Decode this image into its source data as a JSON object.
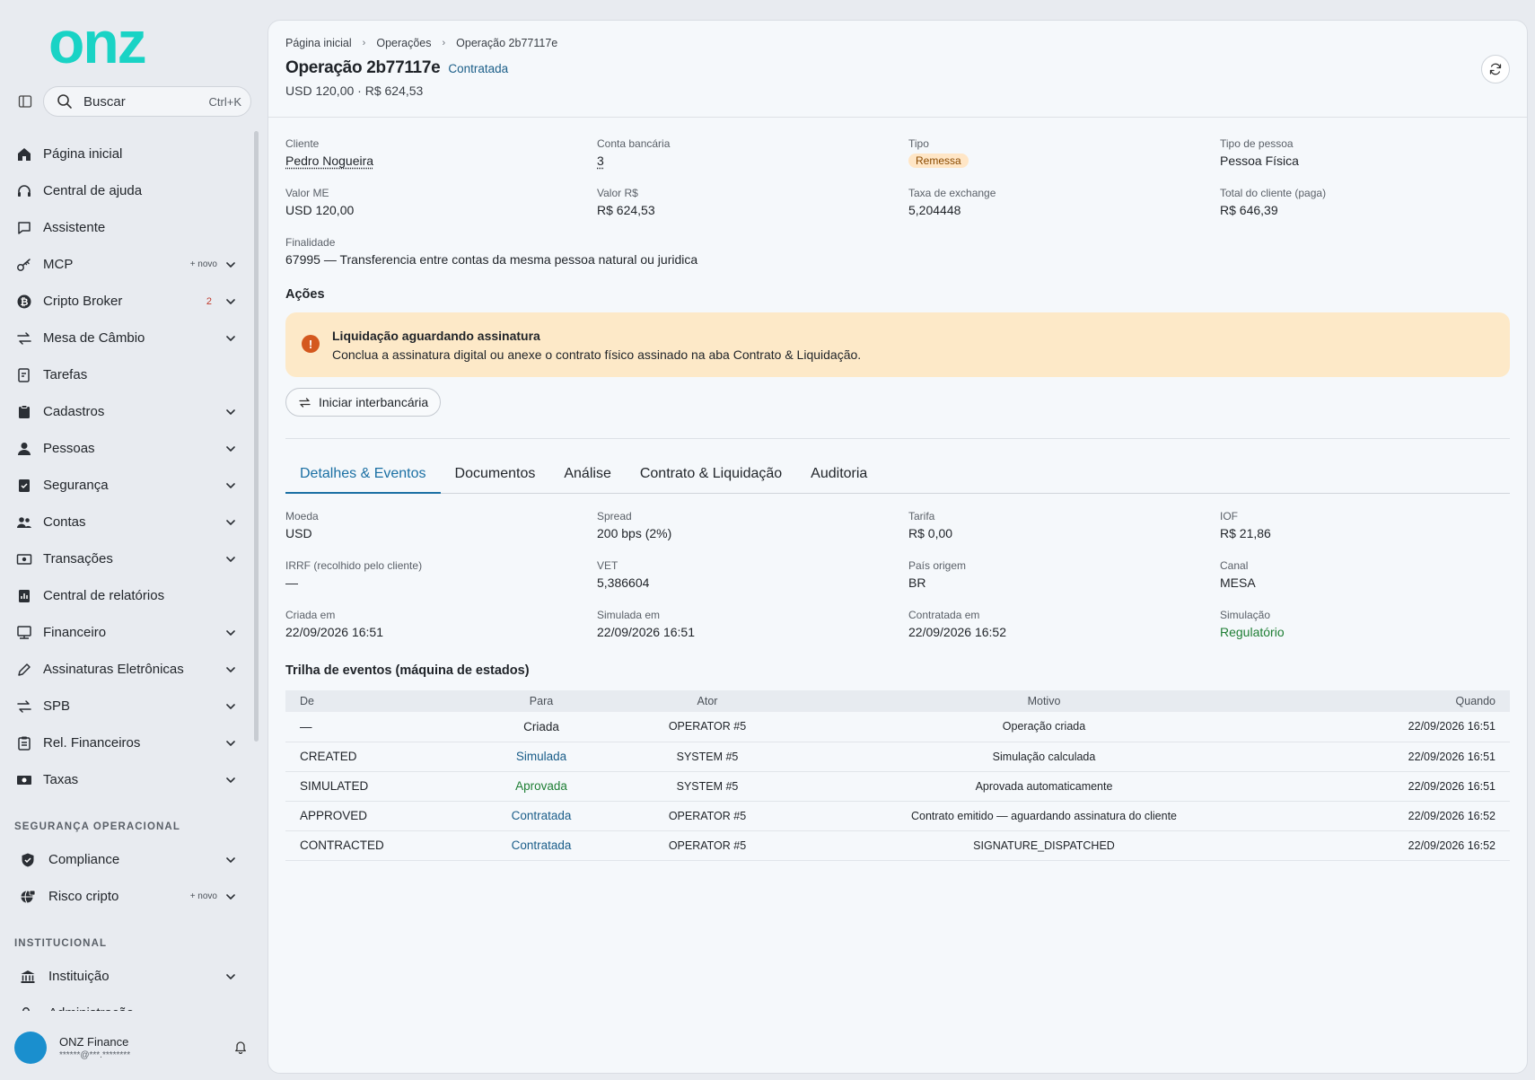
{
  "brand": {
    "logo_text": "onz",
    "accent_color": "#19d3c5"
  },
  "sidebar": {
    "search": {
      "label": "Buscar",
      "shortcut": "Ctrl+K"
    },
    "items": [
      {
        "id": "home",
        "label": "Página inicial",
        "icon": "home-icon",
        "chevron": false
      },
      {
        "id": "help",
        "label": "Central de ajuda",
        "icon": "headset-icon",
        "chevron": false
      },
      {
        "id": "assistant",
        "label": "Assistente",
        "icon": "chat-icon",
        "chevron": false
      },
      {
        "id": "mcp",
        "label": "MCP",
        "icon": "key-icon",
        "badge": "+ novo",
        "chevron": true
      },
      {
        "id": "crypto",
        "label": "Cripto Broker",
        "icon": "bitcoin-icon",
        "count": "2",
        "chevron": true
      },
      {
        "id": "fx",
        "label": "Mesa de Câmbio",
        "icon": "exchange-icon",
        "chevron": true
      },
      {
        "id": "tasks",
        "label": "Tarefas",
        "icon": "task-icon",
        "chevron": false
      },
      {
        "id": "registry",
        "label": "Cadastros",
        "icon": "clipboard-icon",
        "chevron": true
      },
      {
        "id": "people",
        "label": "Pessoas",
        "icon": "person-icon",
        "chevron": true
      },
      {
        "id": "security",
        "label": "Segurança",
        "icon": "shield-check-icon",
        "chevron": true
      },
      {
        "id": "accounts",
        "label": "Contas",
        "icon": "users-icon",
        "chevron": true
      },
      {
        "id": "transactions",
        "label": "Transações",
        "icon": "money-icon",
        "chevron": true
      },
      {
        "id": "reports",
        "label": "Central de relatórios",
        "icon": "report-icon",
        "chevron": false
      },
      {
        "id": "finance",
        "label": "Financeiro",
        "icon": "register-icon",
        "chevron": true
      },
      {
        "id": "esign",
        "label": "Assinaturas Eletrônicas",
        "icon": "pen-icon",
        "chevron": true
      },
      {
        "id": "spb",
        "label": "SPB",
        "icon": "exchange-icon",
        "chevron": true
      },
      {
        "id": "finrel",
        "label": "Rel. Financeiros",
        "icon": "clipboard-list-icon",
        "chevron": true
      },
      {
        "id": "fees",
        "label": "Taxas",
        "icon": "cash-icon",
        "chevron": true
      }
    ],
    "section_security": "SEGURANÇA OPERACIONAL",
    "security_items": [
      {
        "id": "compliance",
        "label": "Compliance",
        "icon": "shield-icon",
        "chevron": true
      },
      {
        "id": "crypto-risk",
        "label": "Risco cripto",
        "icon": "globe-lock-icon",
        "badge": "+ novo",
        "chevron": true
      }
    ],
    "section_institutional": "INSTITUCIONAL",
    "institutional_items": [
      {
        "id": "institution",
        "label": "Instituição",
        "icon": "bank-icon",
        "chevron": true
      },
      {
        "id": "admin",
        "label": "Administração",
        "icon": "user-cog-icon",
        "chevron": true
      }
    ],
    "user": {
      "name": "ONZ Finance",
      "email": "******@***.********"
    }
  },
  "header": {
    "breadcrumbs": [
      "Página inicial",
      "Operações",
      "Operação 2b77117e"
    ],
    "title": "Operação 2b77117e",
    "status": "Contratada",
    "subtitle": "USD 120,00 · R$ 624,53"
  },
  "summary": [
    {
      "label": "Cliente",
      "value": "Pedro Nogueira",
      "style": "link"
    },
    {
      "label": "Conta bancária",
      "value": "3",
      "style": "link"
    },
    {
      "label": "Tipo",
      "value": "Remessa",
      "style": "pill"
    },
    {
      "label": "Tipo de pessoa",
      "value": "Pessoa Física",
      "style": ""
    },
    {
      "label": "Valor ME",
      "value": "USD 120,00",
      "style": ""
    },
    {
      "label": "Valor R$",
      "value": "R$ 624,53",
      "style": ""
    },
    {
      "label": "Taxa de exchange",
      "value": "5,204448",
      "style": ""
    },
    {
      "label": "Total do cliente (paga)",
      "value": "R$ 646,39",
      "style": ""
    }
  ],
  "purpose": {
    "label": "Finalidade",
    "value": "67995 — Transferencia entre contas da mesma pessoa natural ou juridica"
  },
  "actions": {
    "title": "Ações",
    "alert_title": "Liquidação aguardando assinatura",
    "alert_text": "Conclua a assinatura digital ou anexe o contrato físico assinado na aba Contrato & Liquidação.",
    "button": "Iniciar interbancária"
  },
  "tabs": [
    {
      "label": "Detalhes & Eventos",
      "active": true
    },
    {
      "label": "Documentos",
      "active": false
    },
    {
      "label": "Análise",
      "active": false
    },
    {
      "label": "Contrato & Liquidação",
      "active": false
    },
    {
      "label": "Auditoria",
      "active": false
    }
  ],
  "details": [
    {
      "label": "Moeda",
      "value": "USD",
      "style": ""
    },
    {
      "label": "Spread",
      "value": "200 bps (2%)",
      "style": ""
    },
    {
      "label": "Tarifa",
      "value": "R$ 0,00",
      "style": ""
    },
    {
      "label": "IOF",
      "value": "R$ 21,86",
      "style": ""
    },
    {
      "label": "IRRF (recolhido pelo cliente)",
      "value": "—",
      "style": ""
    },
    {
      "label": "VET",
      "value": "5,386604",
      "style": ""
    },
    {
      "label": "País origem",
      "value": "BR",
      "style": ""
    },
    {
      "label": "Canal",
      "value": "MESA",
      "style": ""
    },
    {
      "label": "Criada em",
      "value": "22/09/2026 16:51",
      "style": ""
    },
    {
      "label": "Simulada em",
      "value": "22/09/2026 16:51",
      "style": ""
    },
    {
      "label": "Contratada em",
      "value": "22/09/2026 16:52",
      "style": ""
    },
    {
      "label": "Simulação",
      "value": "Regulatório",
      "style": "green"
    }
  ],
  "events": {
    "title": "Trilha de eventos (máquina de estados)",
    "columns": [
      "De",
      "Para",
      "Ator",
      "Motivo",
      "Quando"
    ],
    "rows": [
      {
        "from": "—",
        "to": "Criada",
        "to_color": "plain",
        "actor": "OPERATOR #5",
        "reason": "Operação criada",
        "when": "22/09/2026 16:51"
      },
      {
        "from": "CREATED",
        "to": "Simulada",
        "to_color": "blue",
        "actor": "SYSTEM #5",
        "reason": "Simulação calculada",
        "when": "22/09/2026 16:51"
      },
      {
        "from": "SIMULATED",
        "to": "Aprovada",
        "to_color": "green",
        "actor": "SYSTEM #5",
        "reason": "Aprovada automaticamente",
        "when": "22/09/2026 16:51"
      },
      {
        "from": "APPROVED",
        "to": "Contratada",
        "to_color": "blue",
        "actor": "OPERATOR #5",
        "reason": "Contrato emitido — aguardando assinatura do cliente",
        "when": "22/09/2026 16:52"
      },
      {
        "from": "CONTRACTED",
        "to": "Contratada",
        "to_color": "blue",
        "actor": "OPERATOR #5",
        "reason": "SIGNATURE_DISPATCHED",
        "when": "22/09/2026 16:52"
      }
    ]
  }
}
